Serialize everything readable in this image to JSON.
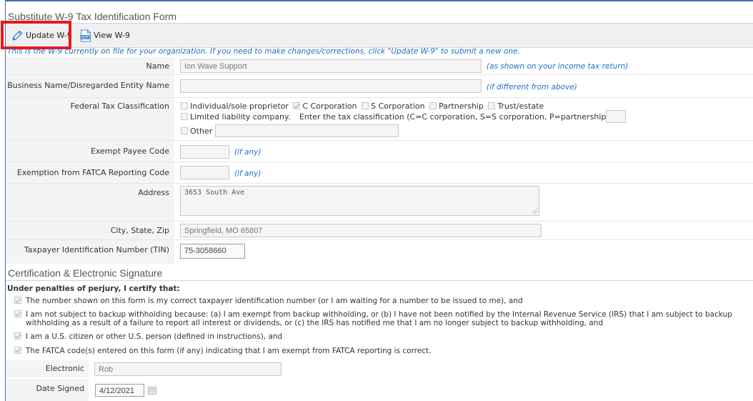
{
  "form": {
    "title": "Substitute W-9 Tax Identification Form",
    "toolbar": {
      "update_label": "Update W-9",
      "view_label": "View W-9",
      "pdf_icon_text": "PDF"
    },
    "notice": "This is the W-9 currently on file for your organization. If you need to make changes/corrections, click \"Update W-9\" to submit a new one.",
    "fields": {
      "name": {
        "label": "Name",
        "value": "Ion Wave Support",
        "hint": "(as shown on your income tax return)"
      },
      "business_name": {
        "label": "Business Name/Disregarded Entity Name",
        "value": "",
        "hint": "(if different from above)"
      },
      "tax_class": {
        "label": "Federal Tax Classification",
        "options": [
          {
            "label": "Individual/sole proprietor",
            "checked": false
          },
          {
            "label": "C Corporation",
            "checked": true
          },
          {
            "label": "S Corporation",
            "checked": false
          },
          {
            "label": "Partnership",
            "checked": false
          },
          {
            "label": "Trust/estate",
            "checked": false
          }
        ],
        "llc_label": "Limited liability company.",
        "llc_instruction": "Enter the tax classification (C=C corporation, S=S corporation, P=partnership):",
        "llc_value": "",
        "other_label": "Other",
        "other_value": ""
      },
      "exempt_payee": {
        "label": "Exempt Payee Code",
        "value": "",
        "hint": "(if any)"
      },
      "fatca": {
        "label": "Exemption from FATCA Reporting Code",
        "value": "",
        "hint": "(if any)"
      },
      "address": {
        "label": "Address",
        "value": "3653 South Ave"
      },
      "city": {
        "label": "City, State, Zip",
        "value": "Springfield, MO 65807"
      },
      "tin": {
        "label": "Taxpayer Identification Number (TIN)",
        "value": "75-3058660"
      }
    }
  },
  "certification": {
    "title": "Certification & Electronic Signature",
    "heading": "Under penalties of perjury, I certify that:",
    "items": [
      {
        "text": "The number shown on this form is my correct taxpayer identification number (or I am waiting for a number to be issued to me), and",
        "checked": true
      },
      {
        "text": "I am not subject to backup withholding because: (a) I am exempt from backup withholding, or (b) I have not been notified by the Internal Revenue Service (IRS) that I am subject to backup withholding as a result of a failure to report all interest or dividends, or (c) the IRS has notified me that I am no longer subject to backup withholding, and",
        "checked": true
      },
      {
        "text": "I am a U.S. citizen or other U.S. person (defined in instructions), and",
        "checked": true
      },
      {
        "text": "The FATCA code(s) entered on this form (if any) indicating that I am exempt from FATCA reporting is correct.",
        "checked": true
      }
    ],
    "signature": {
      "label": "Electronic Signature",
      "value": "Rob"
    },
    "date": {
      "label": "Date Signed",
      "value": "4/12/2021"
    }
  },
  "colors": {
    "accent": "#1f6fc4",
    "highlight": "#e8171e",
    "frame": "#3d6fb0"
  },
  "icons": {
    "update": "pencil-icon",
    "view": "pdf-icon",
    "date": "calendar-icon"
  }
}
